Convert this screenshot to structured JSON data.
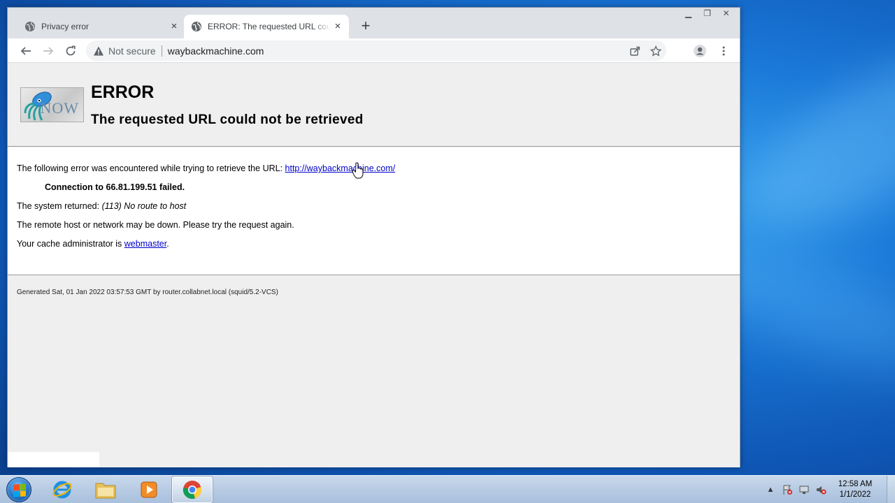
{
  "browser": {
    "tabs": [
      {
        "title": "Privacy error",
        "active": false
      },
      {
        "title": "ERROR: The requested URL could not be retrieved",
        "active": true
      }
    ],
    "new_tab": "+",
    "close_glyph": "×",
    "omnibox": {
      "security_label": "Not secure",
      "url": "waybackmachine.com"
    }
  },
  "page": {
    "h1": "ERROR",
    "h2": "The requested URL could not be retrieved",
    "logo_text": "NOW",
    "line1_prefix": "The following error was encountered while trying to retrieve the URL: ",
    "line1_link": "http://waybackmachine.com/",
    "line2": "Connection to 66.81.199.51 failed.",
    "line3_prefix": "The system returned: ",
    "line3_em": "(113) No route to host",
    "line4": "The remote host or network may be down. Please try the request again.",
    "line5_prefix": "Your cache administrator is ",
    "line5_link": "webmaster",
    "line5_suffix": ".",
    "footer": "Generated Sat, 01 Jan 2022 03:57:53 GMT by router.collabnet.local (squid/5.2-VCS)"
  },
  "taskbar": {
    "clock_time": "12:58 AM",
    "clock_date": "1/1/2022",
    "pinned": [
      "internet-explorer",
      "windows-explorer",
      "media-player",
      "chrome"
    ]
  },
  "colors": {
    "link": "#0000cc",
    "chrome_tabstrip": "#dee1e6",
    "page_bg": "#efefef"
  }
}
